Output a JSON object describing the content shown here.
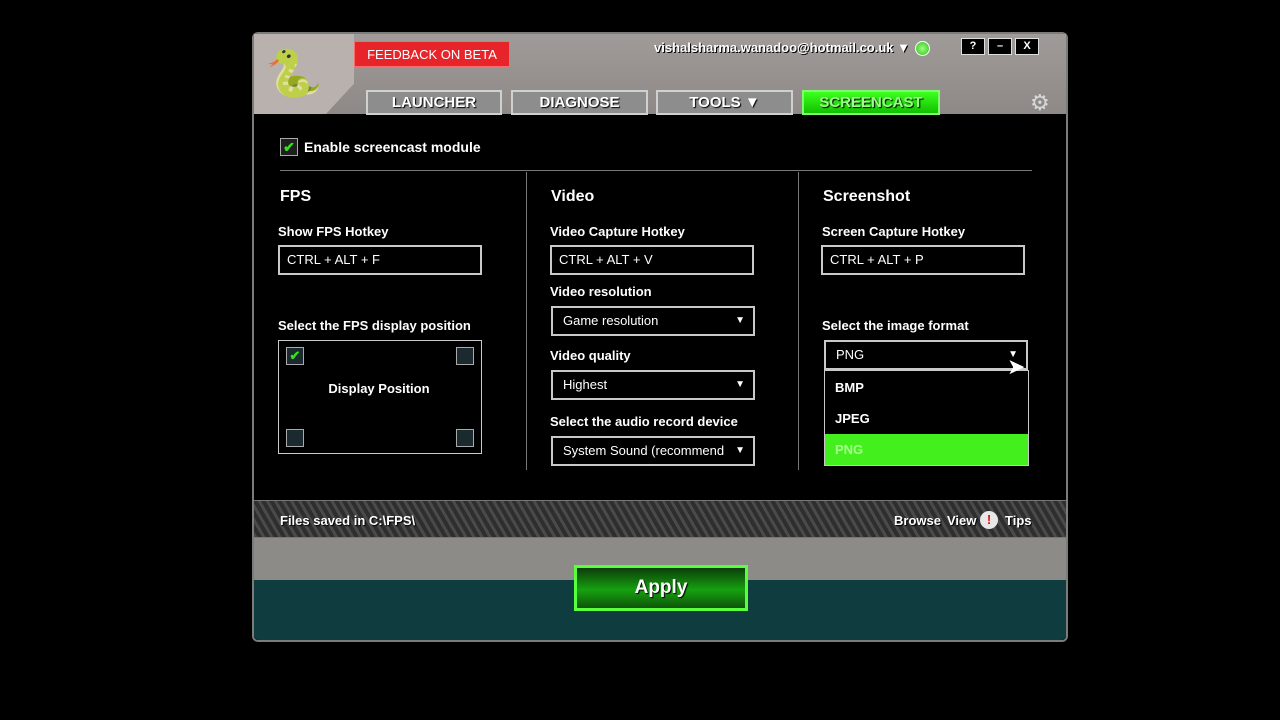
{
  "header": {
    "feedback_label": "FEEDBACK ON BETA",
    "account": "vishalsharma.wanadoo@hotmail.co.uk",
    "account_caret": "▼",
    "window_buttons": [
      "?",
      "–",
      "X"
    ]
  },
  "tabs": [
    {
      "label": "LAUNCHER"
    },
    {
      "label": "DIAGNOSE"
    },
    {
      "label": "TOOLS ▼"
    },
    {
      "label": "SCREENCAST"
    }
  ],
  "enable": {
    "label": "Enable screencast module",
    "checked": true
  },
  "fps": {
    "title": "FPS",
    "hotkey_label": "Show FPS Hotkey",
    "hotkey_value": "CTRL + ALT + F",
    "position_label": "Select the FPS display position",
    "position_box_label": "Display Position"
  },
  "video": {
    "title": "Video",
    "hotkey_label": "Video Capture Hotkey",
    "hotkey_value": "CTRL + ALT + V",
    "resolution_label": "Video resolution",
    "resolution_value": "Game resolution",
    "quality_label": "Video quality",
    "quality_value": "Highest",
    "audio_label": "Select the audio record device",
    "audio_value": "System Sound (recommend"
  },
  "screenshot": {
    "title": "Screenshot",
    "hotkey_label": "Screen Capture Hotkey",
    "hotkey_value": "CTRL + ALT + P",
    "format_label": "Select the image format",
    "format_value": "PNG",
    "format_options": [
      "BMP",
      "JPEG",
      "PNG"
    ]
  },
  "files": {
    "text": "Files saved in    C:\\FPS\\",
    "browse": "Browse",
    "view": "View",
    "tips": "Tips"
  },
  "apply_label": "Apply",
  "colors": {
    "accent": "#3cff1e",
    "feedback": "#e8242b"
  }
}
